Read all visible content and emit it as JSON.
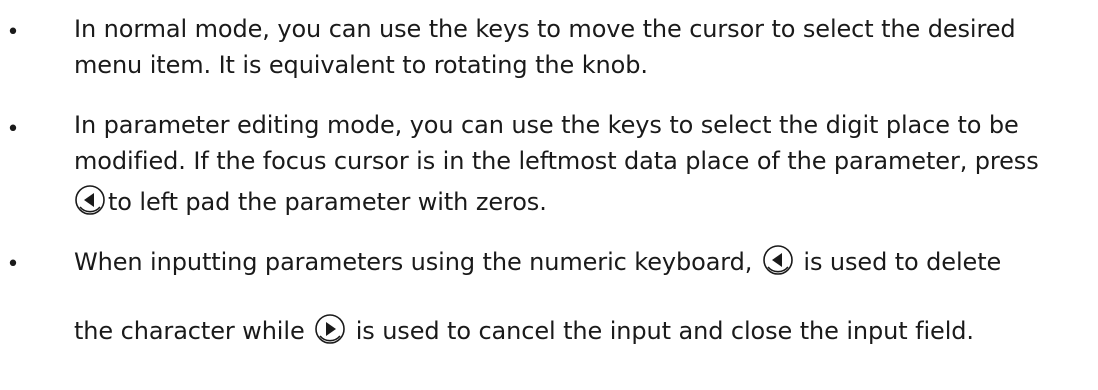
{
  "bullets": [
    {
      "symbol": "•",
      "lines": [
        "In normal mode, you can use the keys to move the cursor to select the desired",
        "menu item. It is equivalent to rotating the knob."
      ]
    },
    {
      "symbol": "•",
      "lines": [
        "In parameter editing mode, you can use the keys to select the digit place to be",
        "modified. If the focus cursor is in the leftmost data place of the parameter, press"
      ],
      "line3_text": "to left pad the parameter with zeros."
    },
    {
      "symbol": "•",
      "line1_a": "When inputting parameters using the numeric keyboard,",
      "line1_b": "is used to delete",
      "line2_a": "the character while",
      "line2_b": "is used to cancel the input and close the input field."
    }
  ],
  "icons": {
    "left": "left-arrow-key-icon",
    "right": "right-arrow-key-icon"
  }
}
